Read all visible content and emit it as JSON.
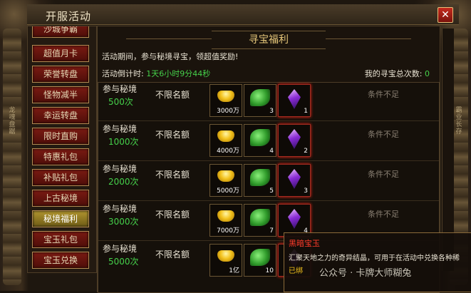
{
  "window": {
    "title": "开服活动",
    "close_label": "✕"
  },
  "side_decor": {
    "left": "龙魂盘踞",
    "right": "霸业长存"
  },
  "sidebar": {
    "items": [
      {
        "label": "沙城争霸"
      },
      {
        "label": "超值月卡"
      },
      {
        "label": "荣誉转盘"
      },
      {
        "label": "怪物减半"
      },
      {
        "label": "幸运转盘"
      },
      {
        "label": "限时直购"
      },
      {
        "label": "特惠礼包"
      },
      {
        "label": "补贴礼包"
      },
      {
        "label": "上古秘境"
      },
      {
        "label": "秘境福利"
      },
      {
        "label": "宝玉礼包"
      },
      {
        "label": "宝玉兑换"
      }
    ],
    "active_index": 9
  },
  "panel": {
    "banner": "寻宝福利",
    "description": "活动期间，参与秘境寻宝，领超值奖励!",
    "countdown_label": "活动倒计时:",
    "countdown_value": "1天6小时9分44秒",
    "total_label": "我的寻宝总次数:",
    "total_value": "0"
  },
  "rows": [
    {
      "task": "参与秘境",
      "count": "500次",
      "limit": "不限名额",
      "gold_qty": "3000万",
      "jade_qty": "3",
      "gem_qty": "1",
      "status": "条件不足"
    },
    {
      "task": "参与秘境",
      "count": "1000次",
      "limit": "不限名额",
      "gold_qty": "4000万",
      "jade_qty": "4",
      "gem_qty": "2",
      "status": "条件不足"
    },
    {
      "task": "参与秘境",
      "count": "2000次",
      "limit": "不限名额",
      "gold_qty": "5000万",
      "jade_qty": "5",
      "gem_qty": "3",
      "status": "条件不足"
    },
    {
      "task": "参与秘境",
      "count": "3000次",
      "limit": "不限名额",
      "gold_qty": "7000万",
      "jade_qty": "7",
      "gem_qty": "4",
      "status": "条件不足"
    },
    {
      "task": "参与秘境",
      "count": "5000次",
      "limit": "不限名额",
      "gold_qty": "1亿",
      "jade_qty": "10",
      "gem_qty": "",
      "status": ""
    }
  ],
  "tooltip": {
    "title": "黑暗宝玉",
    "desc": "汇聚天地之力的奇异结晶，可用于在活动中兑换各种稀",
    "hint": "已绑"
  },
  "watermark": "公众号 · 卡牌大师糊兔"
}
